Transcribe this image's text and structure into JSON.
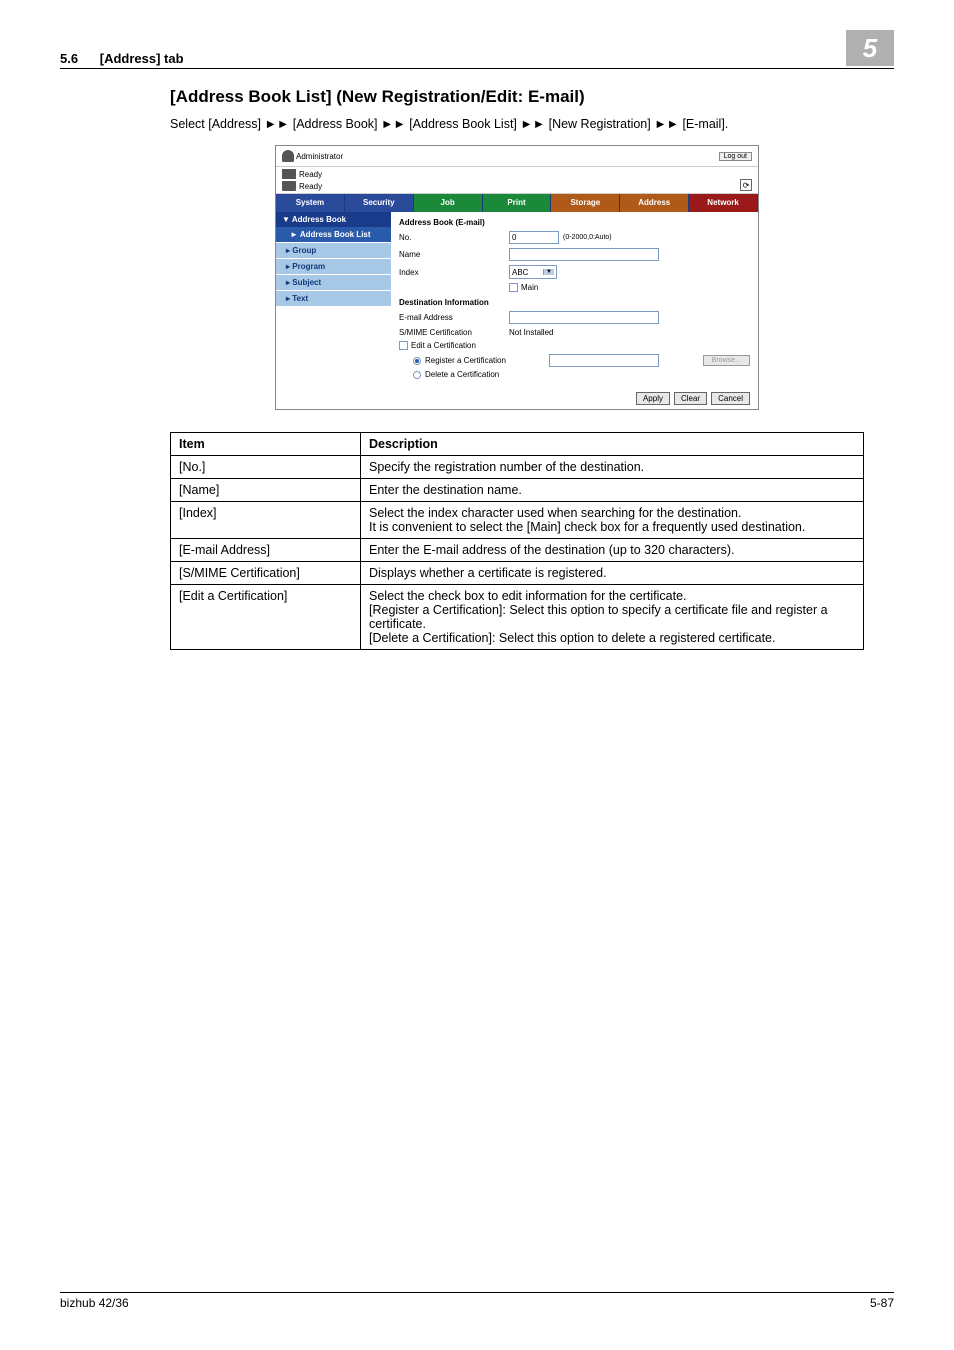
{
  "header": {
    "section_no": "5.6",
    "section_title": "[Address] tab",
    "chapter": "5"
  },
  "section": {
    "title": "[Address Book List] (New Registration/Edit: E-mail)",
    "breadcrumb_prefix": "Select ",
    "bc1": "[Address]",
    "bc2": "[Address Book]",
    "bc3": "[Address Book List]",
    "bc4": "[New Registration]",
    "bc5": "[E-mail].",
    "sep": " ►► "
  },
  "screenshot": {
    "admin_label": "Administrator",
    "logout": "Log out",
    "ready1": "Ready",
    "ready2": "Ready",
    "tabs": {
      "system": "System",
      "security": "Security",
      "job": "Job",
      "print": "Print",
      "storage": "Storage",
      "address": "Address",
      "network": "Network"
    },
    "side": {
      "address_book": "▼ Address Book",
      "address_book_list": "► Address Book List",
      "group": "Group",
      "program": "Program",
      "subject": "Subject",
      "text": "Text"
    },
    "form": {
      "heading1": "Address Book (E-mail)",
      "no_label": "No.",
      "no_value": "0",
      "no_hint": "(0-2000,0:Auto)",
      "name_label": "Name",
      "index_label": "Index",
      "index_value": "ABC",
      "main_label": "Main",
      "heading2": "Destination Information",
      "email_label": "E-mail Address",
      "smime_label": "S/MIME Certification",
      "smime_value": "Not Installed",
      "edit_cert_label": "Edit a Certification",
      "register_cert": "Register a Certification",
      "delete_cert": "Delete a Certification",
      "browse": "Browse...",
      "apply": "Apply",
      "clear": "Clear",
      "cancel": "Cancel"
    }
  },
  "table": {
    "h_item": "Item",
    "h_desc": "Description",
    "rows": [
      {
        "item": "[No.]",
        "desc": "Specify the registration number of the destination."
      },
      {
        "item": "[Name]",
        "desc": "Enter the destination name."
      },
      {
        "item": "[Index]",
        "desc": "Select the index character used when searching for the destination.\nIt is convenient to select the [Main] check box for a frequently used destination."
      },
      {
        "item": "[E-mail Address]",
        "desc": "Enter the E-mail address of the destination (up to 320 characters)."
      },
      {
        "item": "[S/MIME Certification]",
        "desc": "Displays whether a certificate is registered."
      },
      {
        "item": "[Edit a Certification]",
        "desc": "Select the check box to edit information for the certificate.\n[Register a Certification]: Select this option to specify a certificate file and register a certificate.\n[Delete a Certification]: Select this option to delete a registered certificate."
      }
    ]
  },
  "footer": {
    "model": "bizhub 42/36",
    "page": "5-87"
  }
}
